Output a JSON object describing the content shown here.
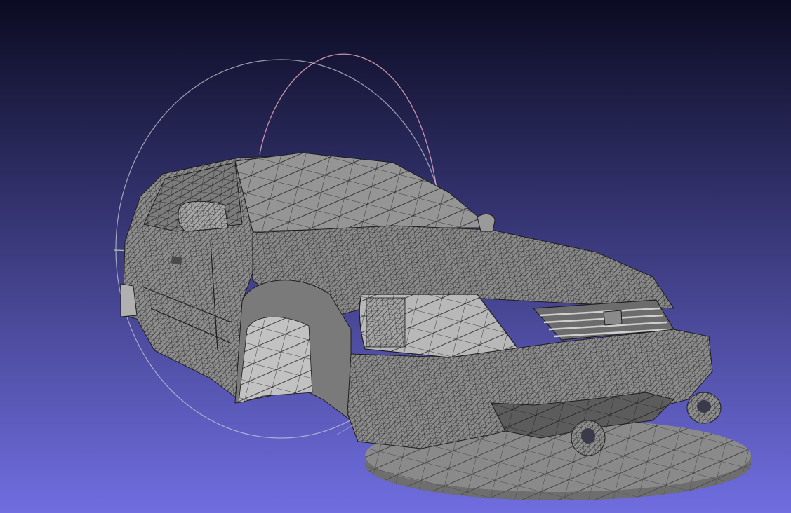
{
  "viewport": {
    "background_top": "#0b0b22",
    "background_bottom": "#706ee0",
    "mesh_fill": "#8c8c8c",
    "mesh_fill_light": "#b8b8b8",
    "mesh_fill_dark": "#5a5a5a",
    "wire_color": "#1e1e1e",
    "trackball_color": "#c8c8d6",
    "trackball_x_axis_color": "#e8a8b8",
    "trackball_y_axis_color": "#a8e0a8",
    "base_plate_fill": "#6e6e6e",
    "model_description": "car-mesh"
  }
}
